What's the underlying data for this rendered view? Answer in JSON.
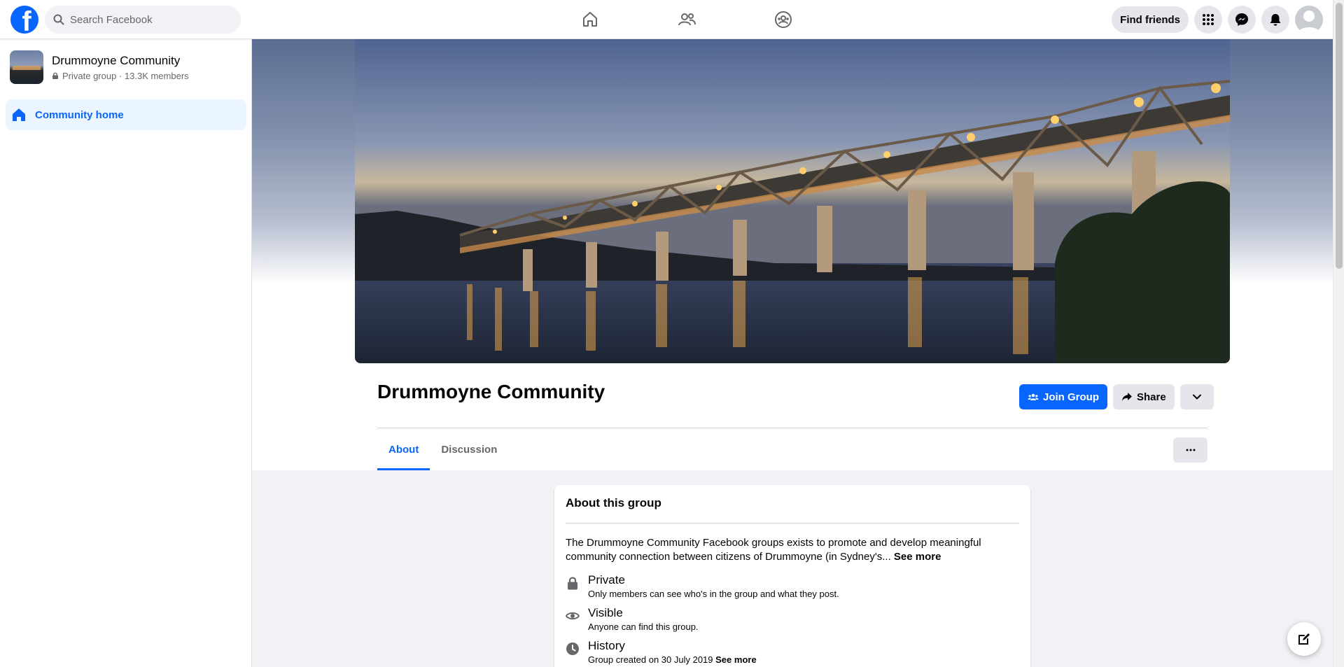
{
  "topbar": {
    "logo_letter": "f",
    "search_placeholder": "Search Facebook",
    "nav_icons": [
      "home-icon",
      "friends-icon",
      "groups-icon"
    ],
    "find_friends_label": "Find friends",
    "right_icons": [
      "menu-grid-icon",
      "messenger-icon",
      "notifications-icon",
      "profile-avatar"
    ]
  },
  "sidebar": {
    "group_name": "Drummoyne Community",
    "group_privacy": "Private group",
    "group_separator": " · ",
    "group_members": "13.3K members",
    "items": [
      {
        "label": "Community home",
        "icon": "home-icon",
        "active": true
      }
    ]
  },
  "header": {
    "title": "Drummoyne Community",
    "join_label": "Join Group",
    "share_label": "Share",
    "tabs": [
      {
        "label": "About",
        "active": true
      },
      {
        "label": "Discussion",
        "active": false
      }
    ]
  },
  "about": {
    "title": "About this group",
    "description": "The Drummoyne Community Facebook groups exists to promote and develop meaningful community connection between citizens of Drummoyne (in Sydney's...",
    "see_more_label": "See more",
    "items": [
      {
        "title": "Private",
        "subtitle": "Only members can see who's in the group and what they post.",
        "icon": "lock-icon"
      },
      {
        "title": "Visible",
        "subtitle": "Anyone can find this group.",
        "icon": "eye-icon"
      },
      {
        "title": "History",
        "subtitle": "Group created on 30 July 2019",
        "link": "See more",
        "icon": "clock-icon"
      }
    ]
  },
  "colors": {
    "brand": "#0866ff",
    "page_bg": "#f0f2f5",
    "active_bg": "#ebf5ff"
  }
}
